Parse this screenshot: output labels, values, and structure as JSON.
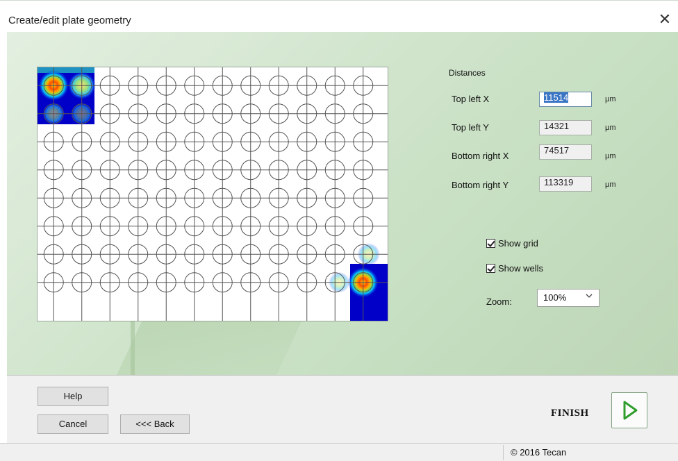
{
  "window": {
    "title": "Create/edit plate geometry",
    "close_symbol": "✕"
  },
  "plate": {
    "columns": 12,
    "rows": 8,
    "show_grid": true,
    "show_wells": true,
    "heatmap_corners": [
      "top-left",
      "bottom-right"
    ]
  },
  "distances": {
    "heading": "Distances",
    "fields": [
      {
        "label": "Top left X",
        "value": "11514",
        "unit": "µm",
        "focused": true
      },
      {
        "label": "Top left Y",
        "value": "14321",
        "unit": "µm",
        "focused": false
      },
      {
        "label": "Bottom right X",
        "value": "74517",
        "unit": "µm",
        "focused": false
      },
      {
        "label": "Bottom right Y",
        "value": "113319",
        "unit": "µm",
        "focused": false
      }
    ]
  },
  "options": {
    "show_grid": {
      "label": "Show grid",
      "checked": true
    },
    "show_wells": {
      "label": "Show wells",
      "checked": true
    },
    "zoom": {
      "label": "Zoom:",
      "value": "100%"
    }
  },
  "buttons": {
    "help": "Help",
    "cancel": "Cancel",
    "back": "<<< Back",
    "finish": "FINISH"
  },
  "status": {
    "copyright": "© 2016 Tecan"
  },
  "colors": {
    "accent_green": "#2f9e2f",
    "heat_blue": "#0000c8",
    "heat_hot": "#ff3a00",
    "selection": "#3a74c4"
  },
  "icons": {
    "close": "close-icon",
    "finish": "play-arrow-icon",
    "zoom_dropdown": "chevron-down-icon",
    "checkbox": "checkmark-icon"
  }
}
